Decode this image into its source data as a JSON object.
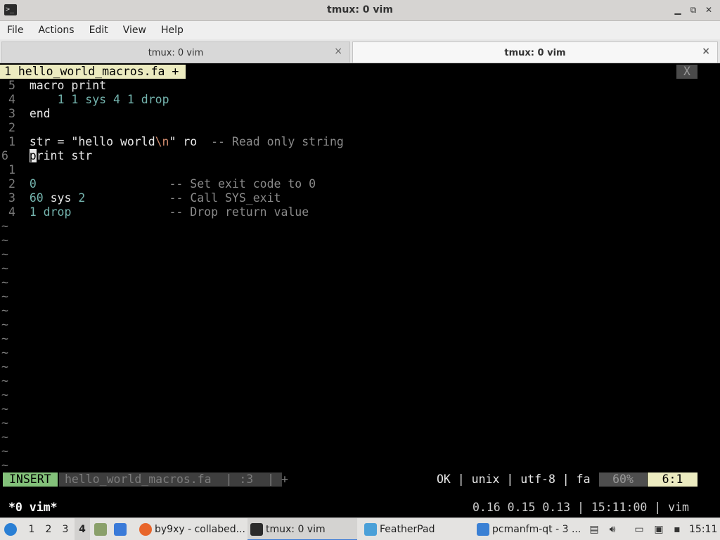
{
  "window": {
    "title": "tmux: 0 vim",
    "minimize": "▁",
    "maximize": "⧉",
    "close": "✕"
  },
  "menu": [
    "File",
    "Actions",
    "Edit",
    "View",
    "Help"
  ],
  "tabs": [
    {
      "label": "tmux: 0 vim",
      "close": "×"
    },
    {
      "label": "tmux: 0 vim",
      "close": "×"
    }
  ],
  "vim": {
    "tabline_active": "1 hello_world_macros.fa +",
    "tabline_close": "X",
    "lines": [
      {
        "num": "5",
        "parts": [
          {
            "t": "macro print",
            "c": "code"
          }
        ]
      },
      {
        "num": "4",
        "parts": [
          {
            "t": "    ",
            "c": "code"
          },
          {
            "t": "1 1",
            "c": "num"
          },
          {
            "t": " sys ",
            "c": "num"
          },
          {
            "t": "4 1",
            "c": "num"
          },
          {
            "t": " drop",
            "c": "num"
          }
        ]
      },
      {
        "num": "3",
        "parts": [
          {
            "t": "end",
            "c": "code"
          }
        ]
      },
      {
        "num": "2",
        "parts": []
      },
      {
        "num": "1",
        "parts": [
          {
            "t": "str = \"hello world",
            "c": "code"
          },
          {
            "t": "\\n",
            "c": "esc"
          },
          {
            "t": "\" ro  ",
            "c": "code"
          },
          {
            "t": "-- Read only string",
            "c": "cmt"
          }
        ]
      },
      {
        "num": "6",
        "parts": [
          {
            "t": "p",
            "c": "cursor"
          },
          {
            "t": "rint str",
            "c": "code"
          }
        ],
        "current": true
      },
      {
        "num": "1",
        "parts": []
      },
      {
        "num": "2",
        "parts": [
          {
            "t": "0",
            "c": "num"
          },
          {
            "t": "                   ",
            "c": "code"
          },
          {
            "t": "-- Set exit code to 0",
            "c": "cmt"
          }
        ]
      },
      {
        "num": "3",
        "parts": [
          {
            "t": "60",
            "c": "num"
          },
          {
            "t": " sys ",
            "c": "code"
          },
          {
            "t": "2",
            "c": "num"
          },
          {
            "t": "            ",
            "c": "code"
          },
          {
            "t": "-- Call SYS_exit",
            "c": "cmt"
          }
        ]
      },
      {
        "num": "4",
        "parts": [
          {
            "t": "1",
            "c": "num"
          },
          {
            "t": " drop",
            "c": "num"
          },
          {
            "t": "              ",
            "c": "code"
          },
          {
            "t": "-- Drop return value",
            "c": "cmt"
          }
        ]
      }
    ],
    "tilde": "~",
    "tilde_count": 18,
    "status": {
      "mode": "INSERT",
      "file": "hello_world_macros.fa  | :3  | + ",
      "right": "OK | unix | utf-8 | fa",
      "percent": "60%",
      "position": "6:1"
    }
  },
  "tmux": {
    "window": "*0 vim*",
    "right": "0.16 0.15 0.13 | 15:11:00 | vim"
  },
  "taskbar": {
    "workspaces": [
      "1",
      "2",
      "3",
      "4"
    ],
    "tasks": [
      {
        "id": "task-firefox",
        "label": "by9xy - collabed..."
      },
      {
        "id": "task-tmux",
        "label": "tmux: 0 vim"
      },
      {
        "id": "task-feather",
        "label": "FeatherPad"
      },
      {
        "id": "task-pcman",
        "label": "pcmanfm-qt - 3 ..."
      }
    ],
    "clock": "15:11"
  }
}
